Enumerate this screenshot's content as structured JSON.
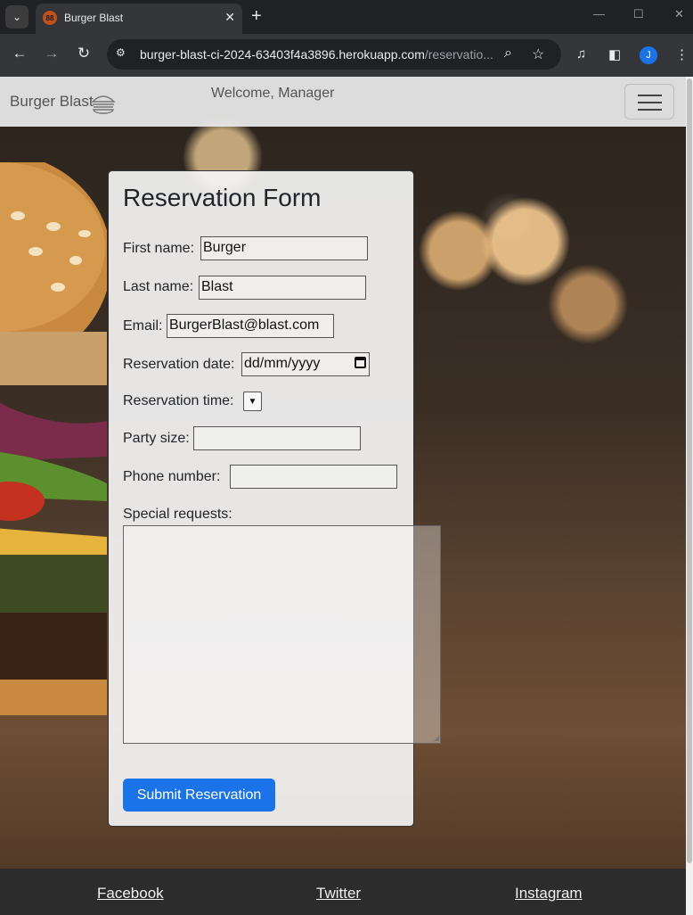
{
  "browser": {
    "tab_title": "Burger Blast",
    "favicon_text": "88",
    "url_host": "burger-blast-ci-2024-63403f4a3896.herokuapp.com",
    "url_path": "/reservatio...",
    "profile_initial": "J"
  },
  "header": {
    "brand": "Burger Blast",
    "welcome": "Welcome, Manager"
  },
  "form": {
    "title": "Reservation Form",
    "first_name_label": "First name:",
    "first_name_value": "Burger",
    "last_name_label": "Last name:",
    "last_name_value": "Blast",
    "email_label": "Email:",
    "email_value": "BurgerBlast@blast.com",
    "date_label": "Reservation date:",
    "date_placeholder": "dd/mm/yyyy",
    "time_label": "Reservation time:",
    "party_label": "Party size:",
    "phone_label": "Phone number:",
    "requests_label": "Special requests:",
    "submit_label": "Submit Reservation"
  },
  "footer": {
    "links": [
      "Facebook",
      "Twitter",
      "Instagram"
    ]
  },
  "colors": {
    "accent": "#1a73e8",
    "footer_bg": "#2c2c2c"
  }
}
